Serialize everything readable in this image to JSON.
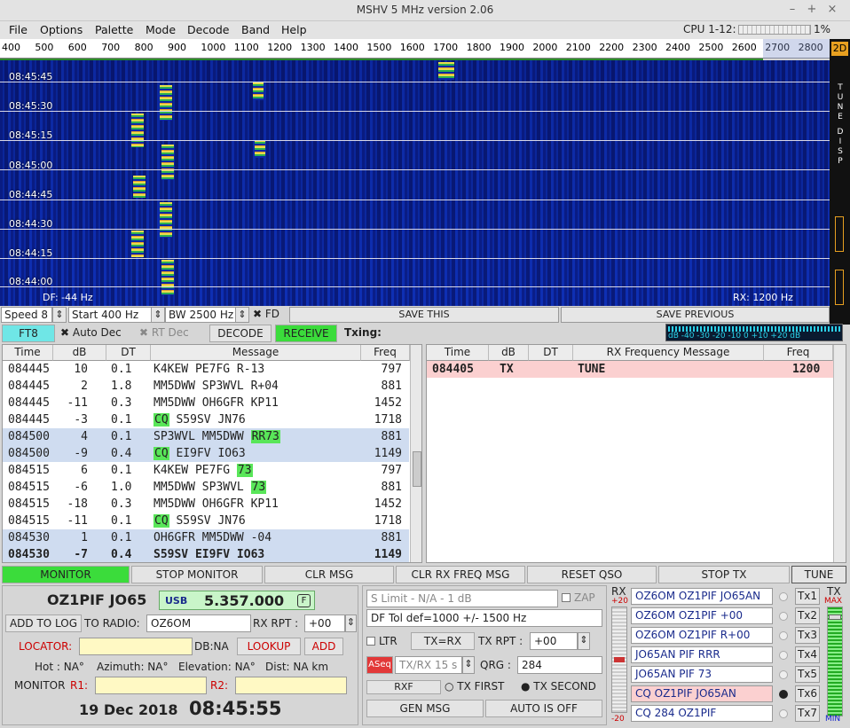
{
  "window": {
    "title": "MSHV 5 MHz version 2.06"
  },
  "menu": [
    "File",
    "Options",
    "Palette",
    "Mode",
    "Decode",
    "Band",
    "Help"
  ],
  "cpu": {
    "label": "CPU 1-12:",
    "pct": "1%"
  },
  "scale": {
    "ticks": [
      "400",
      "500",
      "600",
      "700",
      "800",
      "900",
      "1000",
      "1100",
      "1200",
      "1300",
      "1400",
      "1500",
      "1600",
      "1700",
      "1800",
      "1900",
      "2000",
      "2100",
      "2200",
      "2300",
      "2400",
      "2500",
      "2600",
      "2700",
      "2800"
    ]
  },
  "waterfall": {
    "times": [
      "08:45:45",
      "08:45:30",
      "08:45:15",
      "08:45:00",
      "08:44:45",
      "08:44:30",
      "08:44:15",
      "08:44:00"
    ],
    "df": "DF: -44 Hz",
    "rx": "RX: 1200 Hz",
    "side": "2D",
    "side_tune": "TUNE",
    "side_disp": "DISP"
  },
  "controls": {
    "speed": "Speed 8",
    "start": "Start 400 Hz",
    "bw": "BW 2500 Hz",
    "fd": "FD",
    "save_this": "SAVE THIS",
    "save_prev": "SAVE PREVIOUS"
  },
  "row2": {
    "mode": "FT8",
    "auto_dec": "Auto Dec",
    "rt_dec": "RT Dec",
    "decode": "DECODE",
    "receive": "RECEIVE",
    "txing": "Txing:"
  },
  "meter": {
    "scale": "dB -40 -30 -20 -10 0 +10 +20 dB"
  },
  "left_table": {
    "headers": [
      "Time",
      "dB",
      "DT",
      "Message",
      "Freq"
    ],
    "rows": [
      {
        "time": "084445",
        "db": "10",
        "dt": "0.1",
        "msg": "K4KEW PE7FG R-13",
        "hl": "",
        "freq": "797",
        "shade": false,
        "bold": false
      },
      {
        "time": "084445",
        "db": "2",
        "dt": "1.8",
        "msg": "MM5DWW SP3WVL R+04",
        "hl": "",
        "freq": "881",
        "shade": false,
        "bold": false
      },
      {
        "time": "084445",
        "db": "-11",
        "dt": "0.3",
        "msg": "MM5DWW OH6GFR KP11",
        "hl": "",
        "freq": "1452",
        "shade": false,
        "bold": false
      },
      {
        "time": "084445",
        "db": "-3",
        "dt": "0.1",
        "msg": " S59SV JN76",
        "hl": "CQ",
        "hlpos": "pre",
        "freq": "1718",
        "shade": false,
        "bold": false
      },
      {
        "time": "084500",
        "db": "4",
        "dt": "0.1",
        "msg": "SP3WVL MM5DWW ",
        "hl": "RR73",
        "hlpos": "post",
        "freq": "881",
        "shade": true,
        "bold": false
      },
      {
        "time": "084500",
        "db": "-9",
        "dt": "0.4",
        "msg": " EI9FV IO63",
        "hl": "CQ",
        "hlpos": "pre",
        "freq": "1149",
        "shade": true,
        "bold": false
      },
      {
        "time": "084515",
        "db": "6",
        "dt": "0.1",
        "msg": "K4KEW PE7FG ",
        "hl": "73",
        "hlpos": "post",
        "freq": "797",
        "shade": false,
        "bold": false
      },
      {
        "time": "084515",
        "db": "-6",
        "dt": "1.0",
        "msg": "MM5DWW SP3WVL ",
        "hl": "73",
        "hlpos": "post",
        "freq": "881",
        "shade": false,
        "bold": false
      },
      {
        "time": "084515",
        "db": "-18",
        "dt": "0.3",
        "msg": "MM5DWW OH6GFR KP11",
        "hl": "",
        "freq": "1452",
        "shade": false,
        "bold": false
      },
      {
        "time": "084515",
        "db": "-11",
        "dt": "0.1",
        "msg": " S59SV JN76",
        "hl": "CQ",
        "hlpos": "pre",
        "freq": "1718",
        "shade": false,
        "bold": false
      },
      {
        "time": "084530",
        "db": "1",
        "dt": "0.1",
        "msg": "OH6GFR MM5DWW -04",
        "hl": "",
        "freq": "881",
        "shade": true,
        "bold": false
      },
      {
        "time": "084530",
        "db": "-7",
        "dt": "0.4",
        "msg": "S59SV EI9FV IO63",
        "hl": "",
        "freq": "1149",
        "shade": true,
        "bold": true
      }
    ]
  },
  "right_table": {
    "headers": [
      "Time",
      "dB",
      "DT",
      "RX Frequency Message",
      "Freq"
    ],
    "rows": [
      {
        "time": "084405",
        "db": "TX",
        "dt": "",
        "msg": "TUNE",
        "freq": "1200"
      }
    ]
  },
  "bottom_buttons": [
    "MONITOR",
    "STOP MONITOR",
    "CLR MSG",
    "CLR RX FREQ MSG",
    "RESET QSO",
    "STOP TX",
    "TUNE"
  ],
  "station": {
    "call": "OZ1PIF JO65",
    "mode": "USB",
    "freq": "5.357.000",
    "f": "F",
    "add_log": "ADD TO LOG",
    "to_radio_lbl": "TO RADIO:",
    "to_radio": "OZ6OM",
    "rx_rpt_lbl": "RX RPT :",
    "rx_rpt": "+00",
    "locator_lbl": "LOCATOR:",
    "db_na": "DB:NA",
    "lookup": "LOOKUP",
    "add": "ADD",
    "hot": "Hot  : NA°",
    "azimuth": "Azimuth: NA°",
    "elevation": "Elevation: NA°",
    "dist": "Dist: NA km",
    "monitor": "MONITOR",
    "r1": "R1:",
    "r2": "R2:",
    "date": "19 Dec 2018",
    "time": "08:45:55"
  },
  "mid": {
    "slimit": "S Limit - N/A - 1  dB",
    "zap": "ZAP",
    "dftol": "DF Tol def=1000 +/-  1500  Hz",
    "ltr": "LTR",
    "txrx": "TX=RX",
    "txrpt_lbl": "TX RPT :",
    "txrpt": "+00",
    "aseq": "ASeq",
    "txrx15": "TX/RX 15  s",
    "qrg_lbl": "QRG :",
    "qrg": "284",
    "rxf": "RXF",
    "txfirst": "TX FIRST",
    "txsecond": "TX SECOND",
    "genmsg": "GEN MSG",
    "autooff": "AUTO IS OFF"
  },
  "tx": {
    "rx_lbl": "RX",
    "rx_top": "+20",
    "rx_bot": "-20",
    "tx_lbl": "TX",
    "max": "MAX",
    "min": "MIN",
    "msgs": [
      "OZ6OM OZ1PIF JO65AN",
      "OZ6OM OZ1PIF +00",
      "OZ6OM OZ1PIF R+00",
      "JO65AN PIF RRR",
      "JO65AN PIF 73",
      "CQ OZ1PIF JO65AN",
      "CQ 284 OZ1PIF"
    ],
    "btns": [
      "Tx1",
      "Tx2",
      "Tx3",
      "Tx4",
      "Tx5",
      "Tx6",
      "Tx7"
    ]
  }
}
